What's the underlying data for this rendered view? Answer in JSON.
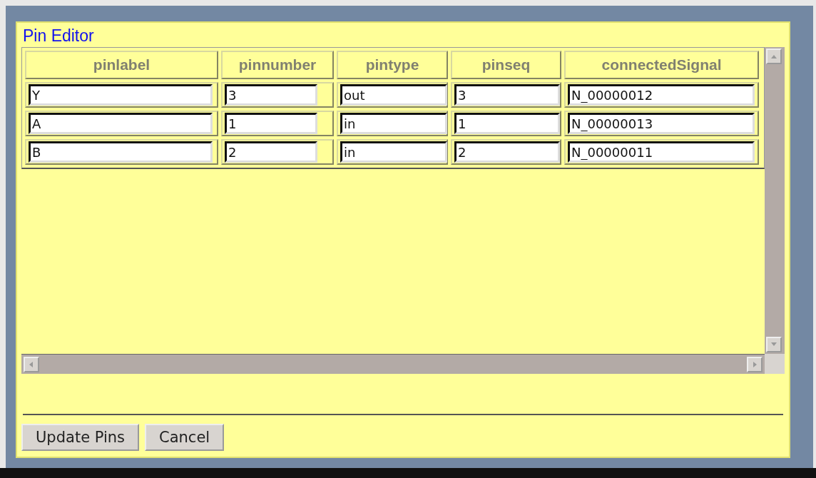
{
  "dialog": {
    "title": "Pin Editor"
  },
  "table": {
    "columns": [
      "pinlabel",
      "pinnumber",
      "pintype",
      "pinseq",
      "connectedSignal"
    ],
    "rows": [
      {
        "pinlabel": "Y",
        "pinnumber": "3",
        "pintype": "out",
        "pinseq": "3",
        "connectedSignal": "N_00000012"
      },
      {
        "pinlabel": "A",
        "pinnumber": "1",
        "pintype": "in",
        "pinseq": "1",
        "connectedSignal": "N_00000013"
      },
      {
        "pinlabel": "B",
        "pinnumber": "2",
        "pintype": "in",
        "pinseq": "2",
        "connectedSignal": "N_00000011"
      }
    ]
  },
  "buttons": [
    "Update Pins",
    "Cancel"
  ]
}
